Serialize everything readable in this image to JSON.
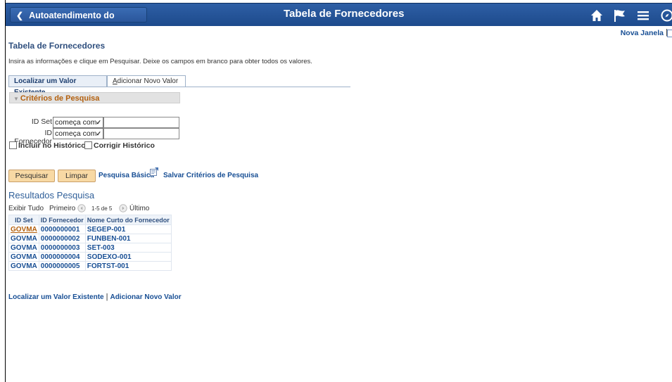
{
  "header": {
    "back_label": "Autoatendimento do Gerente",
    "page_title": "Tabela de Fornecedores",
    "icons": [
      "home-icon",
      "flag-icon",
      "menu-icon",
      "compass-icon"
    ]
  },
  "utility": {
    "new_window": "Nova Janela",
    "separator": "|"
  },
  "page": {
    "title": "Tabela de Fornecedores",
    "instructions": "Insira as informações e clique em Pesquisar. Deixe os campos em branco para obter todos os valores."
  },
  "tabs": {
    "find": "Localizar um Valor Existente",
    "add_prefix": "A",
    "add_rest": "dicionar Novo Valor"
  },
  "criteria": {
    "heading": "Critérios de Pesquisa",
    "setid_label": "ID Set",
    "setid_operator": "começa com",
    "setid_value": "",
    "vendor_label": "ID Fornecedor",
    "vendor_operator": "começa com",
    "vendor_value": "",
    "include_history": "Incluir no Histórico",
    "correct_history": "Corrigir Histórico"
  },
  "buttons": {
    "search": "Pesquisar",
    "clear": "Limpar",
    "basic_search": "Pesquisa Básica",
    "save_criteria": "Salvar Critérios de Pesquisa"
  },
  "results": {
    "title": "Resultados Pesquisa",
    "view_all": "Exibir Tudo",
    "first": "Primeiro",
    "range": "1-5 de 5",
    "last": "Último",
    "columns": [
      "ID Set",
      "ID Fornecedor",
      "Nome Curto do Fornecedor"
    ],
    "rows": [
      [
        "GOVMA",
        "0000000001",
        "SEGEP-001"
      ],
      [
        "GOVMA",
        "0000000002",
        "FUNBEN-001"
      ],
      [
        "GOVMA",
        "0000000003",
        "SET-003"
      ],
      [
        "GOVMA",
        "0000000004",
        "SODEXO-001"
      ],
      [
        "GOVMA",
        "0000000005",
        "FORTST-001"
      ]
    ]
  },
  "footer_links": {
    "find": "Localizar um Valor Existente",
    "separator": "|",
    "add": "Adicionar Novo Valor"
  }
}
